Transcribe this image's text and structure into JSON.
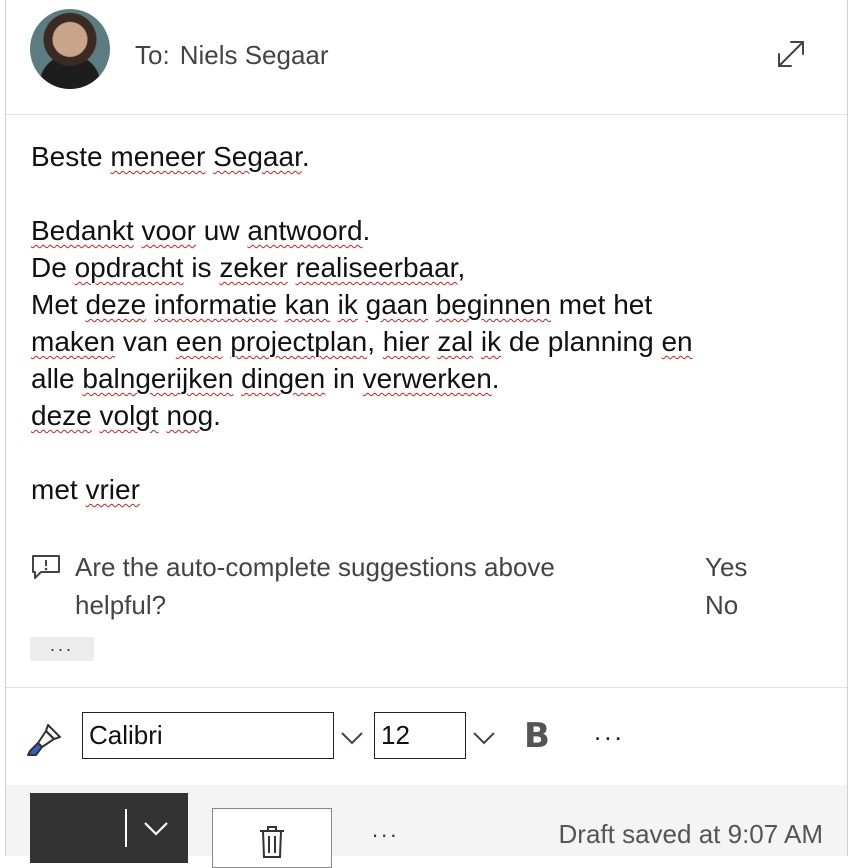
{
  "header": {
    "to_label": "To:",
    "recipient": "Niels Segaar",
    "avatar_icon": "avatar-photo",
    "expand_icon": "expand-icon"
  },
  "body": {
    "lines": [
      [
        {
          "t": "Beste "
        },
        {
          "t": "meneer",
          "s": true
        },
        {
          "t": " "
        },
        {
          "t": "Segaar",
          "s": true
        },
        {
          "t": "."
        }
      ],
      [],
      [
        {
          "t": "Bedankt",
          "s": true
        },
        {
          "t": " "
        },
        {
          "t": "voor",
          "s": true
        },
        {
          "t": " uw "
        },
        {
          "t": "antwoord",
          "s": true
        },
        {
          "t": "."
        }
      ],
      [
        {
          "t": "De "
        },
        {
          "t": "opdracht",
          "s": true
        },
        {
          "t": " is "
        },
        {
          "t": "zeker",
          "s": true
        },
        {
          "t": " "
        },
        {
          "t": "realiseerbaar",
          "s": true
        },
        {
          "t": ","
        }
      ],
      [
        {
          "t": "Met "
        },
        {
          "t": "deze",
          "s": true
        },
        {
          "t": " "
        },
        {
          "t": "informatie",
          "s": true
        },
        {
          "t": " "
        },
        {
          "t": "kan",
          "s": true
        },
        {
          "t": " "
        },
        {
          "t": "ik",
          "s": true
        },
        {
          "t": " "
        },
        {
          "t": "gaan",
          "s": true
        },
        {
          "t": " "
        },
        {
          "t": "beginnen",
          "s": true
        },
        {
          "t": " met het"
        }
      ],
      [
        {
          "t": "maken",
          "s": true
        },
        {
          "t": " van "
        },
        {
          "t": "een",
          "s": true
        },
        {
          "t": " "
        },
        {
          "t": "projectplan",
          "s": true
        },
        {
          "t": ", "
        },
        {
          "t": "hier",
          "s": true
        },
        {
          "t": " "
        },
        {
          "t": "zal",
          "s": true
        },
        {
          "t": " "
        },
        {
          "t": "ik",
          "s": true
        },
        {
          "t": " de planning "
        },
        {
          "t": "en",
          "s": true
        }
      ],
      [
        {
          "t": "alle "
        },
        {
          "t": "balngerijken",
          "s": true
        },
        {
          "t": " "
        },
        {
          "t": "dingen",
          "s": true
        },
        {
          "t": " in "
        },
        {
          "t": "verwerken",
          "s": true
        },
        {
          "t": "."
        }
      ],
      [
        {
          "t": "deze",
          "s": true
        },
        {
          "t": " "
        },
        {
          "t": "volgt",
          "s": true
        },
        {
          "t": " "
        },
        {
          "t": "nog",
          "s": true
        },
        {
          "t": "."
        }
      ],
      [],
      [
        {
          "t": "met "
        },
        {
          "t": "vrier",
          "s": true
        }
      ]
    ]
  },
  "feedback": {
    "question": "Are the auto-complete suggestions above helpful?",
    "yes": "Yes",
    "no": "No",
    "icon": "feedback-icon"
  },
  "quoted_toggle": "...",
  "format_toolbar": {
    "font_family": "Calibri",
    "font_size": "12",
    "bold_label": "B",
    "more": "..."
  },
  "actions": {
    "more": "...",
    "draft_status": "Draft saved at 9:07 AM"
  },
  "colors": {
    "spellcheck": "#d02020",
    "send_button": "#333333",
    "action_bar_bg": "#f4f4f4"
  }
}
